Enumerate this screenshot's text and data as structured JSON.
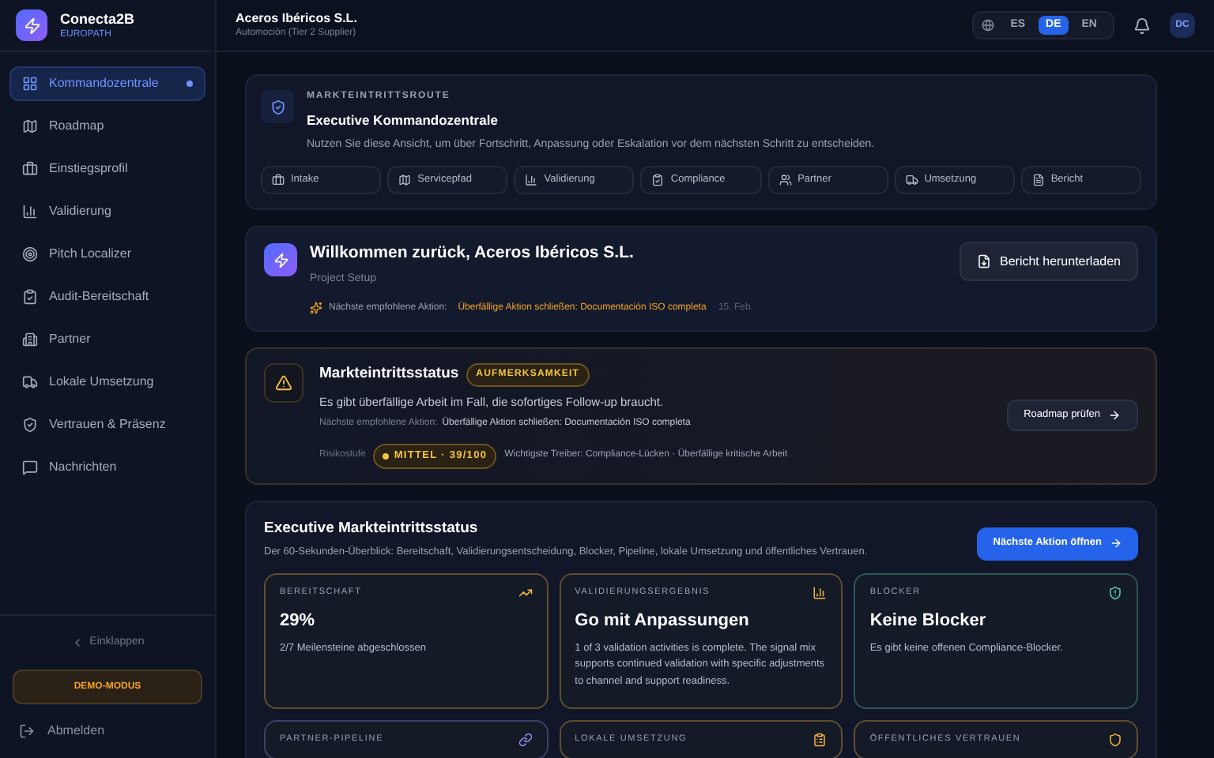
{
  "brand": {
    "name": "Conecta2B",
    "tagline": "EUROPATH"
  },
  "sidebar": {
    "items": [
      {
        "label": "Kommandozentrale",
        "selected": true
      },
      {
        "label": "Roadmap",
        "selected": false
      },
      {
        "label": "Einstiegsprofil",
        "selected": false
      },
      {
        "label": "Validierung",
        "selected": false
      },
      {
        "label": "Pitch Localizer",
        "selected": false
      },
      {
        "label": "Audit-Bereitschaft",
        "selected": false
      },
      {
        "label": "Partner",
        "selected": false
      },
      {
        "label": "Lokale Umsetzung",
        "selected": false
      },
      {
        "label": "Vertrauen & Präsenz",
        "selected": false
      },
      {
        "label": "Nachrichten",
        "selected": false
      }
    ],
    "collapse": "Einklappen",
    "demo_badge": "DEMO-MODUS",
    "logout": "Abmelden"
  },
  "header": {
    "company": "Aceros Ibéricos S.L.",
    "subtitle": "Automoción (Tier 2 Supplier)",
    "languages": [
      {
        "label": "ES",
        "selected": false
      },
      {
        "label": "DE",
        "selected": true
      },
      {
        "label": "EN",
        "selected": false
      }
    ],
    "avatar": "DC"
  },
  "route_card": {
    "eyebrow": "MARKTEINTRITTSROUTE",
    "title": "Executive Kommandozentrale",
    "description": "Nutzen Sie diese Ansicht, um über Fortschritt, Anpassung oder Eskalation vor dem nächsten Schritt zu entscheiden.",
    "steps": [
      "Intake",
      "Servicepfad",
      "Validierung",
      "Compliance",
      "Partner",
      "Umsetzung",
      "Bericht"
    ]
  },
  "welcome_card": {
    "title": "Willkommen zurück, Aceros Ibéricos S.L.",
    "subtitle": "Project Setup",
    "next_label": "Nächste empfohlene Aktion:",
    "next_action": "Überfällige Aktion schließen: Documentación ISO completa",
    "date": "· 15. Feb.",
    "button": "Bericht herunterladen"
  },
  "status_card": {
    "title": "Markteintrittsstatus",
    "badge": "AUFMERKSAMKEIT",
    "message": "Es gibt überfällige Arbeit im Fall, die sofortiges Follow-up braucht.",
    "next_label": "Nächste empfohlene Aktion:",
    "next_action": "Überfällige Aktion schließen: Documentación ISO completa",
    "risk_label": "Risikostufe",
    "risk_value": "MITTEL · 39/100",
    "drivers": "Wichtigste Treiber: Compliance-Lücken · Überfällige kritische Arbeit",
    "button": "Roadmap prüfen"
  },
  "overview": {
    "title": "Executive Markteintrittsstatus",
    "description": "Der 60-Sekunden-Überblick: Bereitschaft, Validierungsentscheidung, Blocker, Pipeline, lokale Umsetzung und öffentliches Vertrauen.",
    "button": "Nächste Aktion öffnen",
    "cards": [
      {
        "label": "BEREITSCHAFT",
        "value": "29%",
        "detail": "2/7 Meilensteine abgeschlossen",
        "color": "#f5b83d"
      },
      {
        "label": "VALIDIERUNGSERGEBNIS",
        "value": "Go mit Anpassungen",
        "detail": "1 of 3 validation activities is complete. The signal mix supports continued validation with specific adjustments to channel and support readiness.",
        "color": "#f5b83d"
      },
      {
        "label": "BLOCKER",
        "value": "Keine Blocker",
        "detail": "Es gibt keine offenen Compliance-Blocker.",
        "color": "#5fd0b0"
      },
      {
        "label": "PARTNER-PIPELINE",
        "color": "#8b8ff0"
      },
      {
        "label": "LOKALE UMSETZUNG",
        "color": "#f5b83d"
      },
      {
        "label": "ÖFFENTLICHES VERTRAUEN",
        "color": "#f5b83d"
      }
    ]
  }
}
